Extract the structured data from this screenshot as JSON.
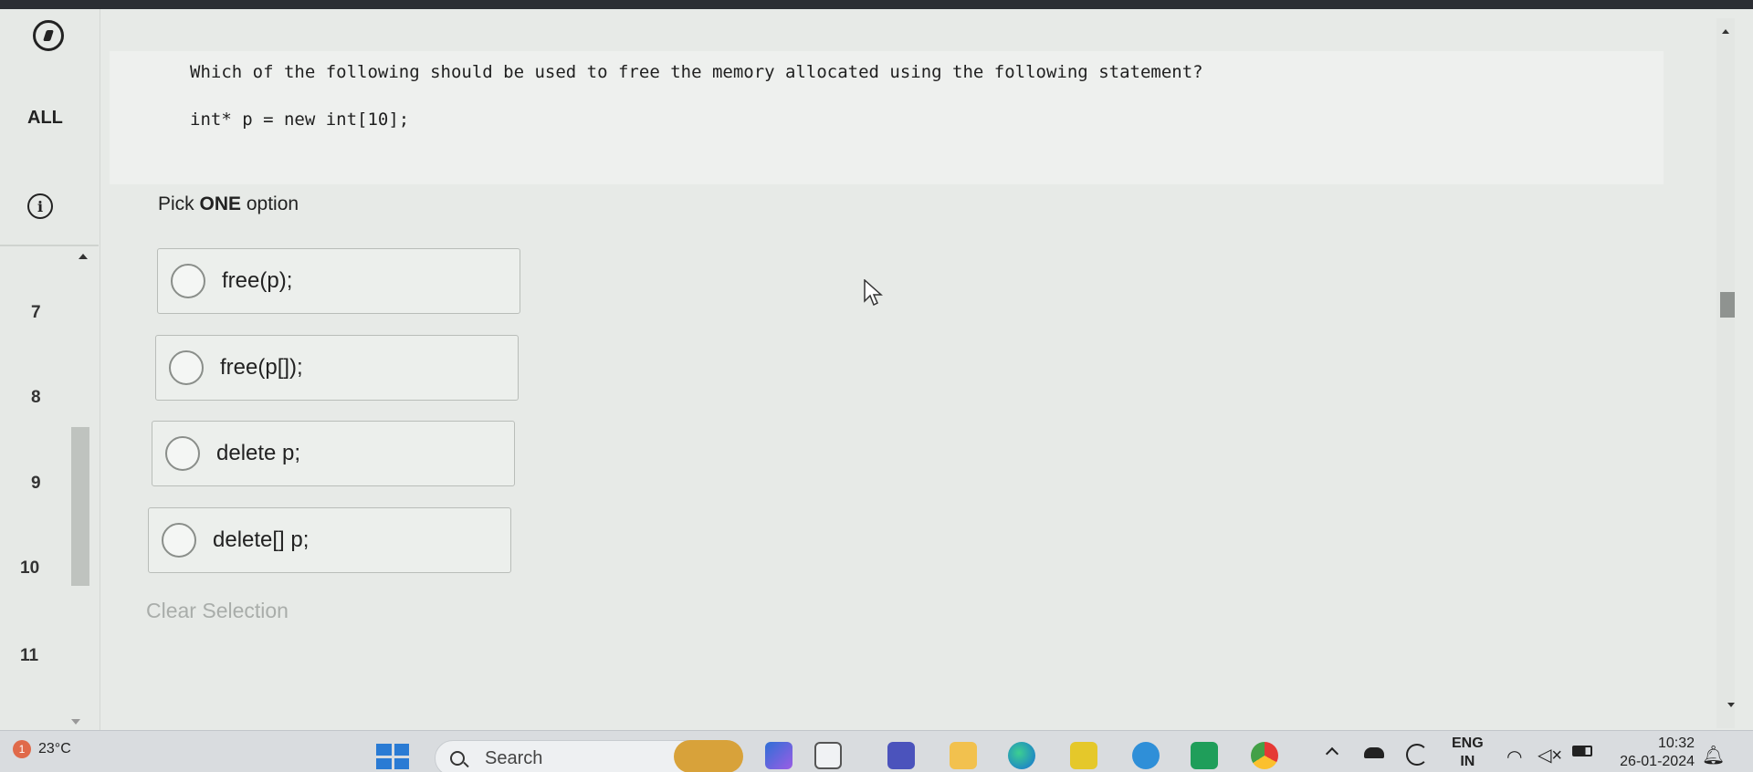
{
  "sidebar": {
    "all_label": "ALL",
    "question_numbers": [
      "7",
      "8",
      "9",
      "10",
      "11"
    ]
  },
  "question": {
    "text": "Which of the following should be used to free the memory allocated using the following statement?",
    "code": "int* p = new int[10];"
  },
  "prompt": {
    "prefix": "Pick ",
    "emphasis": "ONE",
    "suffix": " option"
  },
  "options": [
    {
      "label": "free(p);"
    },
    {
      "label": "free(p[]);"
    },
    {
      "label": "delete p;"
    },
    {
      "label": "delete[] p;"
    }
  ],
  "clear_selection": "Clear Selection",
  "taskbar": {
    "weather_badge": "1",
    "temperature": "23°C",
    "search_label": "Search",
    "language_line1": "ENG",
    "language_line2": "IN",
    "time": "10:32",
    "date": "26-01-2024"
  },
  "colors": {
    "accent_blue": "#2a7bd4",
    "panel_bg": "#eef0ee"
  }
}
